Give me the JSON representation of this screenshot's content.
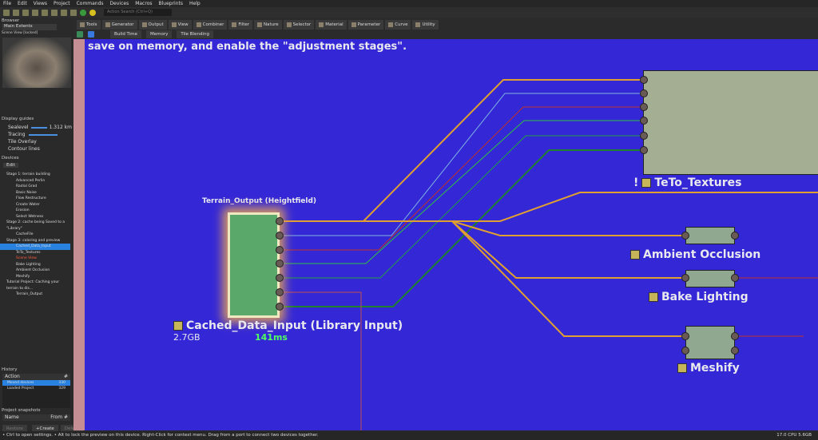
{
  "menu": [
    "File",
    "Edit",
    "Views",
    "Project",
    "Commands",
    "Devices",
    "Macros",
    "Blueprints",
    "Help"
  ],
  "search_placeholder": "Action Search (Ctrl+Q)",
  "tabs": [
    "Tools",
    "Generator",
    "Output",
    "View",
    "Combiner",
    "Filter",
    "Nature",
    "Selector",
    "Material",
    "Parameter",
    "Curve",
    "Utility"
  ],
  "subtoolbar": [
    "Build Time",
    "Memory",
    "Tile Blending"
  ],
  "browser": {
    "title": "Browser",
    "extents": "Main Extents",
    "scene_view": "Scene View [locked]"
  },
  "display_guides": {
    "title": "Display guides",
    "sealevel": "Sealevel",
    "sealevel_value": "1.312 km",
    "tracing": "Tracing",
    "tile_overlay": "Tile Overlay",
    "contour": "Contour lines"
  },
  "devices": {
    "title": "Devices",
    "edit": "Edit",
    "items": [
      {
        "t": "Stage 1: terrain building",
        "s": 1
      },
      {
        "t": "Advanced Perlin"
      },
      {
        "t": "Radial Grad"
      },
      {
        "t": "Basic Noise"
      },
      {
        "t": "Flow Restructure"
      },
      {
        "t": "Create Water"
      },
      {
        "t": "Erosion"
      },
      {
        "t": "Select Wetness"
      },
      {
        "t": "Stage 2: cache being Saved to a \"Library\"",
        "s": 1
      },
      {
        "t": "CacheFile"
      },
      {
        "t": "Stage 3: coloring and preview",
        "s": 1
      },
      {
        "t": "Cached_Data_Input",
        "sel": 1
      },
      {
        "t": "TeTo_Textures"
      },
      {
        "t": "Scene View",
        "red": 1
      },
      {
        "t": "Bake Lighting"
      },
      {
        "t": "Ambient Occlusion"
      },
      {
        "t": "Meshify"
      },
      {
        "t": "Tutorial Project: Caching your terrain to dis...",
        "s": 1
      },
      {
        "t": "Terrain_Output"
      }
    ]
  },
  "history": {
    "title": "History",
    "col_action": "Action",
    "col_num": "#",
    "rows": [
      {
        "a": "Moved devices",
        "n": "330"
      },
      {
        "a": "Loaded Project",
        "n": "329"
      }
    ]
  },
  "snapshots": {
    "title": "Project snapshots",
    "col_name": "Name",
    "col_from": "From #",
    "restore": "Restore",
    "create": "+Create",
    "delete": "Delete"
  },
  "canvas": {
    "banner": "save on memory, and enable the \"adjustment stages\".",
    "terrain_output": "Terrain_Output (Heightfield)",
    "cached": "Cached_Data_Input (Library Input)",
    "size": "2.7GB",
    "time": "141ms",
    "teto": "TeTo_Textures",
    "teto_flag": "!",
    "ao": "Ambient Occlusion",
    "bake": "Bake Lighting",
    "meshify": "Meshify"
  },
  "status": {
    "hint": "• Ctrl to open settings. • Alt to lock the preview on this device. Right-Click for context menu. Drag from a port to connect two devices together.",
    "perf": "17.0 CPU 5.6GB"
  },
  "colors": {
    "canvas": "#3427d6",
    "wire_orange": "#e0a030",
    "wire_blue": "#7fb4e0",
    "wire_red": "#c0302a",
    "wire_green": "#30a040"
  }
}
